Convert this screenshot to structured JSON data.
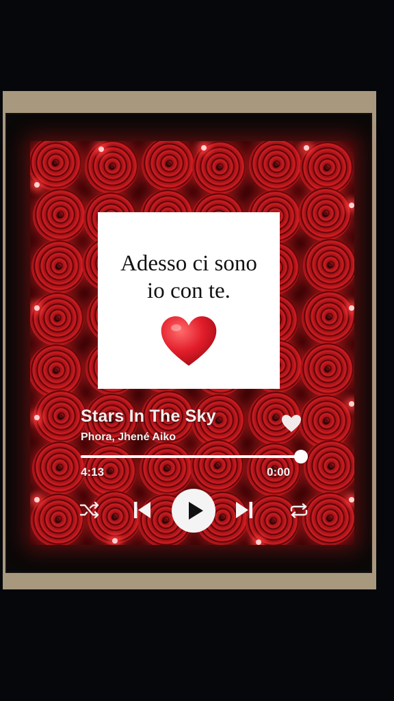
{
  "message": {
    "line1": "Adesso ci sono",
    "line2": "io con te."
  },
  "player": {
    "title": "Stars In The Sky",
    "artist": "Phora, Jhené Aiko",
    "elapsed": "4:13",
    "remaining": "0:00",
    "progress": 1.0
  },
  "icons": {
    "heart": "red-heart-emoji",
    "like": "heart-icon",
    "shuffle": "shuffle-icon",
    "previous": "skip-previous-icon",
    "play": "play-icon",
    "next": "skip-next-icon",
    "repeat": "repeat-icon"
  },
  "colors": {
    "roses": "#b0161c",
    "heart": "#e21d2a",
    "note": "#ffffff"
  }
}
